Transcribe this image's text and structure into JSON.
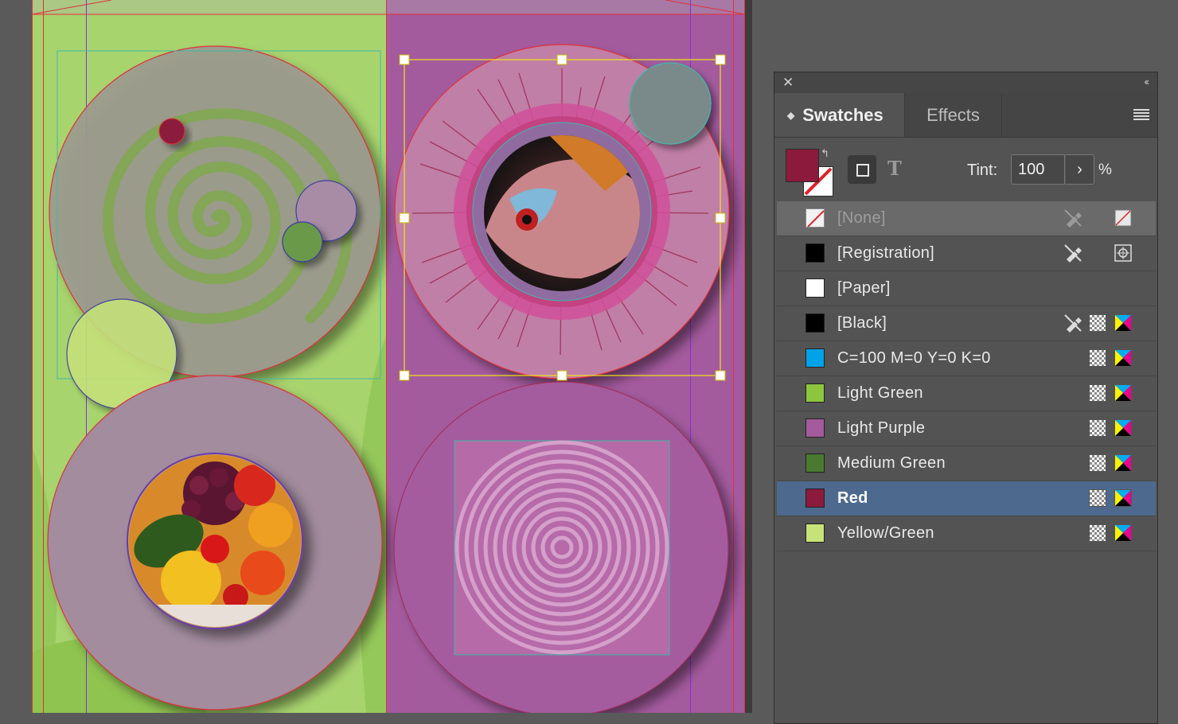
{
  "panel": {
    "tabs": [
      "Swatches",
      "Effects"
    ],
    "tint_label": "Tint:",
    "tint_value": "100",
    "tint_unit": "%",
    "fill_color": "#8b1a3c"
  },
  "swatches": [
    {
      "name": "[None]",
      "color": "none"
    },
    {
      "name": "[Registration]",
      "color": "#000000"
    },
    {
      "name": "[Paper]",
      "color": "#ffffff"
    },
    {
      "name": "[Black]",
      "color": "#000000"
    },
    {
      "name": "C=100 M=0 Y=0 K=0",
      "color": "#00a2e8"
    },
    {
      "name": "Light Green",
      "color": "#8cc63f"
    },
    {
      "name": "Light Purple",
      "color": "#a45b9e"
    },
    {
      "name": "Medium Green",
      "color": "#4a7a30"
    },
    {
      "name": "Red",
      "color": "#8b1a3c"
    },
    {
      "name": "Yellow/Green",
      "color": "#c8e27a"
    }
  ],
  "canvas_colors": {
    "green_page": "#a8d46e",
    "purple_page": "#a45b9e",
    "circle_tint": "#9c8aa0",
    "guide_red": "#e0303a",
    "guide_purple": "#8a2be2",
    "frame_teal": "#3fb8a8",
    "selection_yellow": "#f2e41a"
  }
}
